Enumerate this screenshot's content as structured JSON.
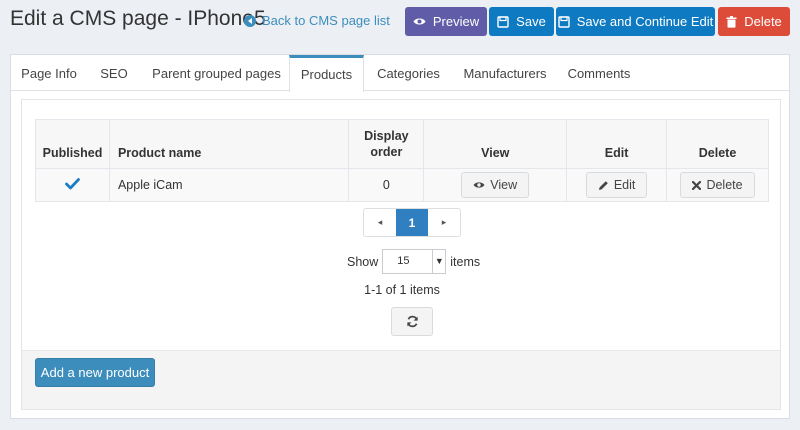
{
  "header": {
    "title": "Edit a CMS page - IPhone5",
    "back_link": "Back to CMS page list"
  },
  "actions": {
    "preview": "Preview",
    "save": "Save",
    "save_continue": "Save and Continue Edit",
    "delete": "Delete"
  },
  "tabs": [
    "Page Info",
    "SEO",
    "Parent grouped pages",
    "Products",
    "Categories",
    "Manufacturers",
    "Comments"
  ],
  "active_tab": "Products",
  "grid": {
    "columns": [
      "Published",
      "Product name",
      "Display order",
      "View",
      "Edit",
      "Delete"
    ],
    "rows": [
      {
        "published": true,
        "product_name": "Apple iCam",
        "display_order": "0",
        "view": "View",
        "edit": "Edit",
        "delete": "Delete"
      }
    ]
  },
  "pager": {
    "prev": "◂",
    "current": "1",
    "next": "▸"
  },
  "page_size": {
    "show_label": "Show",
    "value": "15",
    "items_label": "items"
  },
  "info": "1-1 of 1 items",
  "add_button": "Add a new product",
  "colors": {
    "preview": "#605ca8",
    "save": "#0e7ac2",
    "delete": "#dd4b39",
    "accent": "#3c8dbc"
  }
}
